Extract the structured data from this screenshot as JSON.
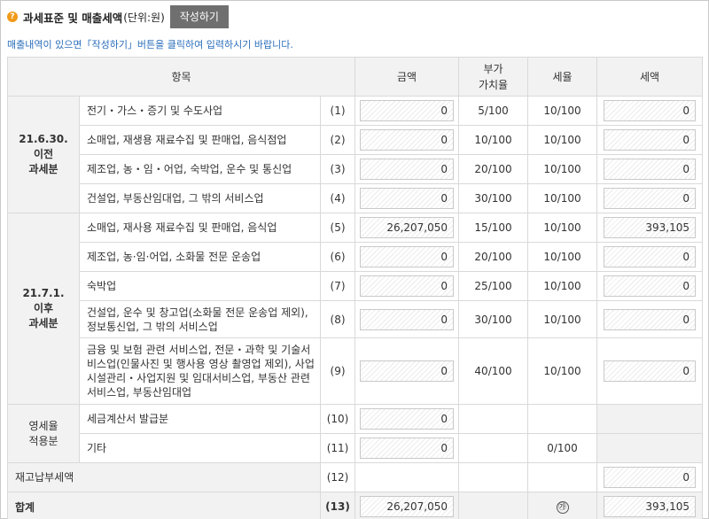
{
  "header": {
    "icon": "question-circle-icon",
    "title": "과세표준 및 매출세액",
    "unit": "(단위:원)",
    "write_button": "작성하기"
  },
  "notice": "매출내역이 있으면「작성하기」버튼을 클릭하여 입력하시기 바랍니다.",
  "columns": {
    "item": "항목",
    "amount": "금액",
    "vat_rate_1": "부가",
    "vat_rate_2": "가치율",
    "tax_rate": "세율",
    "tax": "세액"
  },
  "groups": {
    "g1": [
      "21.6.30.",
      "이전",
      "과세분"
    ],
    "g2": [
      "21.7.1.",
      "이후",
      "과세분"
    ],
    "g3": [
      "영세율",
      "적용분"
    ]
  },
  "rows": [
    {
      "desc": "전기・가스・증기 및 수도사업",
      "no": "(1)",
      "amount": "0",
      "vat_rate": "5/100",
      "tax_rate": "10/100",
      "tax": "0"
    },
    {
      "desc": "소매업, 재생용 재료수집 및 판매업, 음식점업",
      "no": "(2)",
      "amount": "0",
      "vat_rate": "10/100",
      "tax_rate": "10/100",
      "tax": "0"
    },
    {
      "desc": "제조업, 농・임・어업, 숙박업, 운수 및 통신업",
      "no": "(3)",
      "amount": "0",
      "vat_rate": "20/100",
      "tax_rate": "10/100",
      "tax": "0"
    },
    {
      "desc": "건설업, 부동산임대업, 그 밖의 서비스업",
      "no": "(4)",
      "amount": "0",
      "vat_rate": "30/100",
      "tax_rate": "10/100",
      "tax": "0"
    },
    {
      "desc": "소매업, 재사용 재료수집 및 판매업, 음식업",
      "no": "(5)",
      "amount": "26,207,050",
      "vat_rate": "15/100",
      "tax_rate": "10/100",
      "tax": "393,105"
    },
    {
      "desc": "제조업, 농·임·어업, 소화물 전문 운송업",
      "no": "(6)",
      "amount": "0",
      "vat_rate": "20/100",
      "tax_rate": "10/100",
      "tax": "0"
    },
    {
      "desc": "숙박업",
      "no": "(7)",
      "amount": "0",
      "vat_rate": "25/100",
      "tax_rate": "10/100",
      "tax": "0"
    },
    {
      "desc": "건설업, 운수 및 창고업(소화물 전문 운송업 제외), 정보통신업, 그 밖의 서비스업",
      "no": "(8)",
      "amount": "0",
      "vat_rate": "30/100",
      "tax_rate": "10/100",
      "tax": "0"
    },
    {
      "desc": "금융 및 보험 관련 서비스업, 전문・과학 및 기술서비스업(인물사진 및 행사용 영상 촬영업 제외), 사업시설관리・사업지원 및 임대서비스업, 부동산 관련 서비스업, 부동산임대업",
      "no": "(9)",
      "amount": "0",
      "vat_rate": "40/100",
      "tax_rate": "10/100",
      "tax": "0"
    },
    {
      "desc": "세금계산서 발급분",
      "no": "(10)",
      "amount": "0"
    },
    {
      "desc": "기타",
      "no": "(11)",
      "amount": "0",
      "tax_rate": "0/100"
    },
    {
      "label": "재고납부세액",
      "no": "(12)",
      "tax": "0"
    },
    {
      "label": "합계",
      "no": "(13)",
      "amount": "26,207,050",
      "mark": "㉮",
      "tax": "393,105"
    }
  ]
}
